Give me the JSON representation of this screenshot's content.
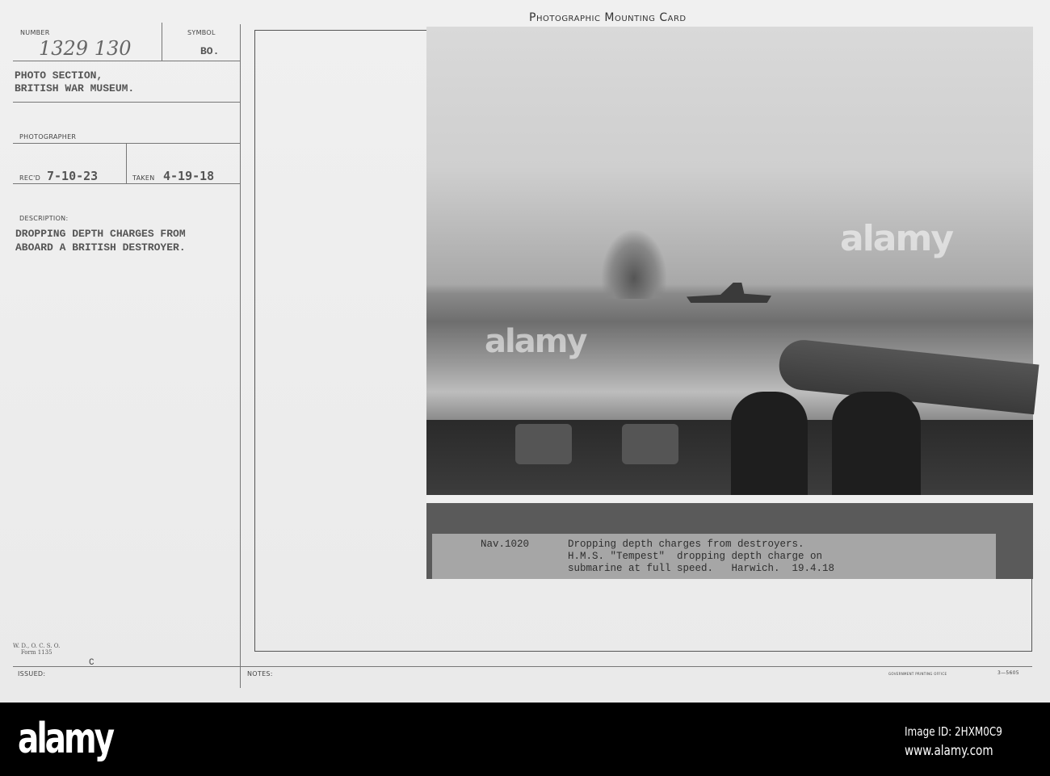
{
  "card": {
    "title": "Photographic Mounting Card",
    "number_label": "NUMBER",
    "number_value": "1329 130",
    "symbol_label": "SYMBOL",
    "symbol_value": "BO.",
    "section_line1": "PHOTO SECTION,",
    "section_line2": "BRITISH WAR MUSEUM.",
    "photographer_label": "PHOTOGRAPHER",
    "recd_label": "REC'D",
    "recd_value": "7-10-23",
    "taken_label": "TAKEN",
    "taken_value": "4-19-18",
    "description_label": "DESCRIPTION:",
    "description_line1": "DROPPING DEPTH CHARGES FROM",
    "description_line2": "ABOARD A BRITISH DESTROYER.",
    "form_line1": "W. D., O. C. S. O.",
    "form_line2": "Form 1135",
    "issued_label": "ISSUED:",
    "issued_value": "C",
    "notes_label": "NOTES:",
    "printer": "GOVERNMENT PRINTING OFFICE",
    "printer_code": "3—5605"
  },
  "photo_caption": {
    "ref": "Nav.1020",
    "line1": "Dropping depth charges from destroyers.",
    "line2": "H.M.S. \"Tempest\"  dropping depth charge on",
    "line3": "submarine at full speed.   Harwich.  19.4.18"
  },
  "watermark": {
    "brand": "alamy",
    "image_id": "Image ID: 2HXM0C9",
    "url": "www.alamy.com"
  }
}
